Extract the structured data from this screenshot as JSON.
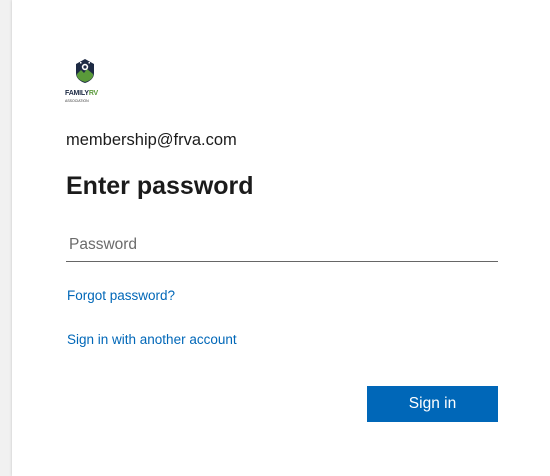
{
  "logo": {
    "name_part1": "FAMILY",
    "name_part2": "RV",
    "sub": "ASSOCIATION",
    "brand_dark": "#1d2a44",
    "brand_green": "#5a9a3a"
  },
  "account": {
    "email": "membership@frva.com"
  },
  "form": {
    "title": "Enter password",
    "password_placeholder": "Password",
    "forgot_label": "Forgot password?",
    "other_account_label": "Sign in with another account",
    "signin_label": "Sign in"
  },
  "colors": {
    "accent": "#0067b8",
    "text": "#1b1b1b"
  }
}
